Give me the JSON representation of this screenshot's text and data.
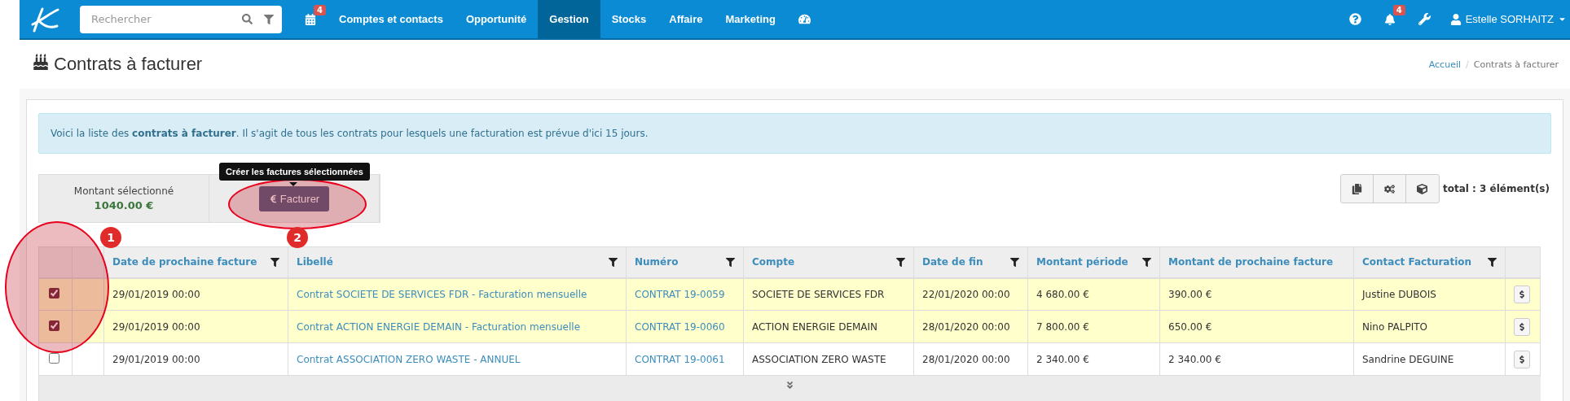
{
  "navbar": {
    "search": {
      "placeholder": "Rechercher"
    },
    "calendar_badge": "4",
    "items": [
      {
        "label": "Comptes et contacts",
        "selected": false
      },
      {
        "label": "Opportunité",
        "selected": false
      },
      {
        "label": "Gestion",
        "selected": true
      },
      {
        "label": "Stocks",
        "selected": false
      },
      {
        "label": "Affaire",
        "selected": false
      },
      {
        "label": "Marketing",
        "selected": false
      }
    ],
    "notifications_badge": "4",
    "user": "Estelle SORHAITZ"
  },
  "page": {
    "title": "Contrats à facturer",
    "breadcrumb": [
      "Accueil",
      "Contrats à facturer"
    ],
    "breadcrumb_separator": "/"
  },
  "alert": "Voici la liste des **contrats à facturer**. Il s'agit de tous les contrats pour lesquels une facturation est prévue d'ici 15 jours.",
  "summary": {
    "label": "Montant sélectionné",
    "amount": "1040.00 €",
    "button": "Facturer",
    "tooltip": "Créer les factures sélectionnées"
  },
  "total": "total : 3 élément(s)",
  "table": {
    "columns": [
      {
        "label": "Date de prochaine facture",
        "filter": true,
        "link": false
      },
      {
        "label": "Libellé",
        "filter": true,
        "link": true
      },
      {
        "label": "Numéro",
        "filter": true,
        "link": true
      },
      {
        "label": "Compte",
        "filter": true,
        "link": false
      },
      {
        "label": "Date de fin",
        "filter": true,
        "link": false
      },
      {
        "label": "Montant période",
        "filter": true,
        "link": false
      },
      {
        "label": "Montant de prochaine facture",
        "filter": false,
        "link": false
      },
      {
        "label": "Contact Facturation",
        "filter": true,
        "link": false
      }
    ],
    "rows": [
      {
        "checked": true,
        "cells": [
          "29/01/2019 00:00",
          "Contrat SOCIETE DE SERVICES FDR - Facturation mensuelle",
          "CONTRAT 19-0059",
          "SOCIETE DE SERVICES FDR",
          "22/01/2020 00:00",
          "4 680.00 €",
          "390.00 €",
          "Justine DUBOIS"
        ]
      },
      {
        "checked": true,
        "cells": [
          "29/01/2019 00:00",
          "Contrat ACTION ENERGIE DEMAIN - Facturation mensuelle",
          "CONTRAT 19-0060",
          "ACTION ENERGIE DEMAIN",
          "28/01/2020 00:00",
          "7 800.00 €",
          "650.00 €",
          "Nino PALPITO"
        ]
      },
      {
        "checked": false,
        "cells": [
          "29/01/2019 00:00",
          "Contrat ASSOCIATION ZERO WASTE - ANNUEL",
          "CONTRAT 19-0061",
          "ASSOCIATION ZERO WASTE",
          "28/01/2020 00:00",
          "2 340.00 €",
          "2 340.00 €",
          "Sandrine DEGUINE"
        ]
      }
    ]
  },
  "annotations": [
    {
      "label": "1"
    },
    {
      "label": "2"
    }
  ]
}
